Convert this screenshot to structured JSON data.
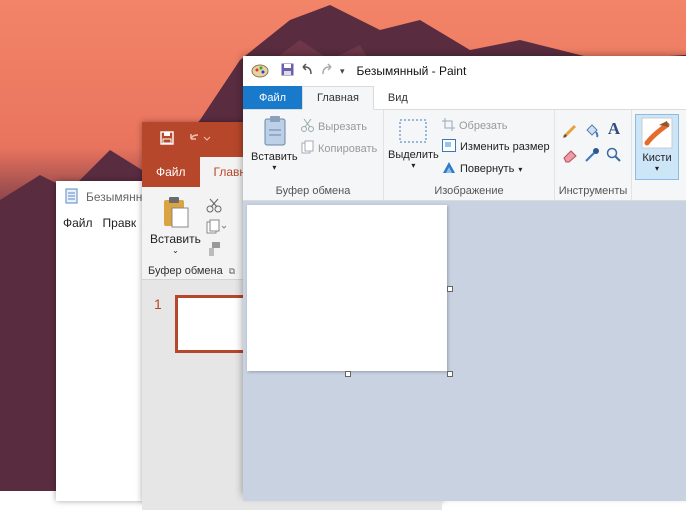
{
  "notepad": {
    "title": "Безымянн",
    "menu": [
      "Файл",
      "Правк"
    ]
  },
  "powerpoint": {
    "tabs": [
      "Файл",
      "Главн"
    ],
    "paste_label": "Вставить",
    "clipboard_group": "Буфер обмена",
    "slide_number": "1"
  },
  "paint": {
    "title": "Безымянный - Paint",
    "tabs": {
      "file": "Файл",
      "home": "Главная",
      "view": "Вид"
    },
    "clipboard": {
      "paste": "Вставить",
      "cut": "Вырезать",
      "copy": "Копировать",
      "group_label": "Буфер обмена"
    },
    "image": {
      "select": "Выделить",
      "crop": "Обрезать",
      "resize": "Изменить размер",
      "rotate": "Повернуть",
      "group_label": "Изображение"
    },
    "tools": {
      "group_label": "Инструменты"
    },
    "brushes": {
      "label": "Кисти"
    }
  },
  "colors": {
    "ppt_accent": "#b7472a",
    "paint_file_tab": "#1979ca",
    "paint_workspace": "#c8d2e1"
  }
}
